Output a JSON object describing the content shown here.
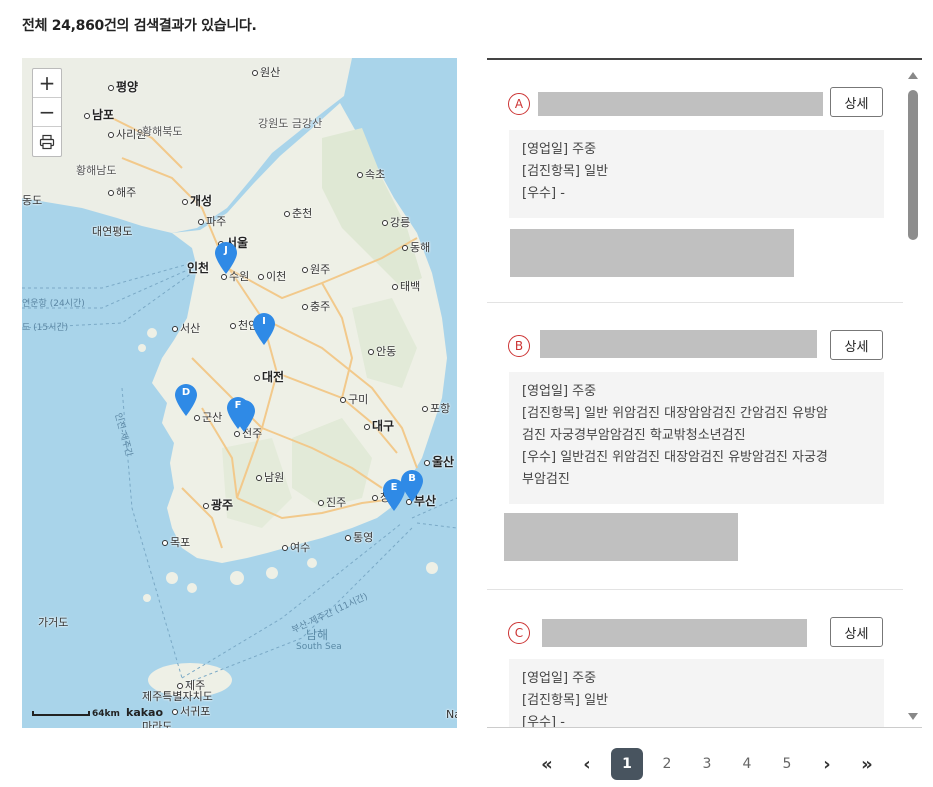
{
  "summary": "전체 24,860건의 검색결과가 있습니다.",
  "map": {
    "controls": {
      "zoom_in": "+",
      "zoom_out": "−",
      "print": "⎙"
    },
    "scale_label": "64km",
    "logo": "kakao",
    "labels": {
      "pyeongyang": "평양",
      "nampo": "남포",
      "sariwon": "사리원",
      "hwanghaebuk": "황해북도",
      "hwanghaenam": "황해남도",
      "haeju": "해주",
      "gaeseong": "개성",
      "wonsan": "원산",
      "gangwon": "강원도 금강산",
      "sokcho": "속초",
      "paju": "파주",
      "chuncheon": "춘천",
      "gangneung": "강릉",
      "seoul": "서울",
      "incheon": "인천",
      "suwon": "수원",
      "icheon": "이천",
      "wonju": "원주",
      "donghae": "동해",
      "taebaek": "태백",
      "chungju": "충주",
      "seosan": "서산",
      "cheonan": "천안",
      "andong": "안동",
      "daejeon": "대전",
      "gumi": "구미",
      "pohang": "포항",
      "gunsan": "군산",
      "jeonju": "전주",
      "daegu": "대구",
      "ulsan": "울산",
      "namwon": "남원",
      "gwangju": "광주",
      "jinju": "진주",
      "changwon": "창원",
      "busan": "부산",
      "mokpo": "목포",
      "yeosu": "여수",
      "tongyeong": "통영",
      "jeju": "제주",
      "jejudo": "제주특별자치도",
      "seogwipo": "서귀포",
      "marado": "마라도",
      "gageodo": "가거도",
      "namhae": "남해",
      "south_sea": "South Sea",
      "daeyeonpyeong": "대연평도",
      "route1": "연운항 (24시간)",
      "route2": "도 (15시간)",
      "route3": "인천-제주간",
      "route4": "부산-제주간 (11시간)",
      "west_edge": "동도",
      "nat": "Na"
    },
    "markers": [
      "J",
      "I",
      "D",
      "F",
      "E",
      "B"
    ]
  },
  "items": [
    {
      "letter": "A",
      "detail_label": "상세",
      "info": [
        "[영업일] 주중",
        "[검진항목] 일반",
        "[우수] -"
      ]
    },
    {
      "letter": "B",
      "detail_label": "상세",
      "info": [
        "[영업일] 주중",
        "[검진항목] 일반 위암검진 대장암암검진 간암검진 유방암",
        "검진 자궁경부암암검진 학교밖청소년검진",
        "[우수] 일반검진 위암검진 대장암검진 유방암검진 자궁경",
        "부암검진"
      ]
    },
    {
      "letter": "C",
      "detail_label": "상세",
      "info": [
        "[영업일] 주중",
        "[검진항목] 일반",
        "[우수] -"
      ]
    }
  ],
  "pagination": {
    "first": "«",
    "prev": "‹",
    "next": "›",
    "last": "»",
    "pages": [
      "1",
      "2",
      "3",
      "4",
      "5"
    ],
    "current": "1"
  },
  "colors": {
    "marker": "#2f8ae6",
    "active_page": "#48545f",
    "letter": "#cc3333"
  }
}
